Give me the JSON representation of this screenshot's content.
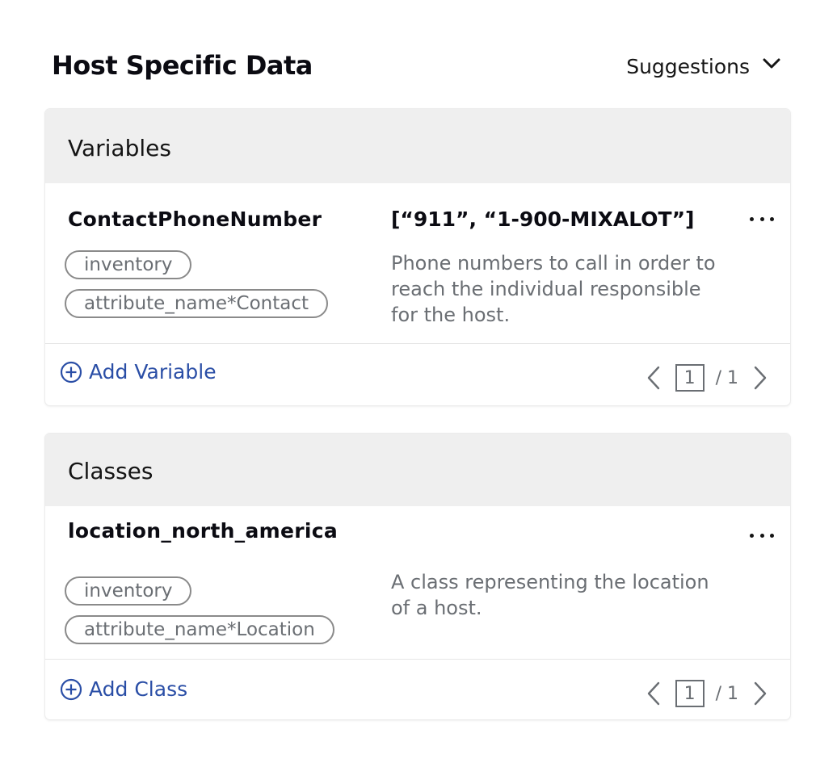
{
  "header": {
    "title": "Host Specific Data",
    "suggestions_label": "Suggestions"
  },
  "variables": {
    "title": "Variables",
    "item": {
      "name": "ContactPhoneNumber",
      "value": "[“911”, “1-900-MIXALOT”]",
      "chips": [
        "inventory",
        "attribute_name*Contact"
      ],
      "description": "Phone numbers to call in order to reach the individual responsible for the host."
    },
    "add_label": "Add Variable",
    "page": {
      "current": "1",
      "total": "/ 1"
    }
  },
  "classes": {
    "title": "Classes",
    "item": {
      "name": "location_north_america",
      "chips": [
        "inventory",
        "attribute_name*Location"
      ],
      "description": "A class representing the location of a host."
    },
    "add_label": "Add Class",
    "page": {
      "current": "1",
      "total": "/ 1"
    }
  },
  "colors": {
    "link": "#2a4ea6",
    "panel_header": "#efefef",
    "muted_text": "#6a6e73"
  },
  "icons": [
    "chevron-down-icon",
    "kebab-icon",
    "plus-circle-icon",
    "chevron-left-icon",
    "chevron-right-icon"
  ]
}
